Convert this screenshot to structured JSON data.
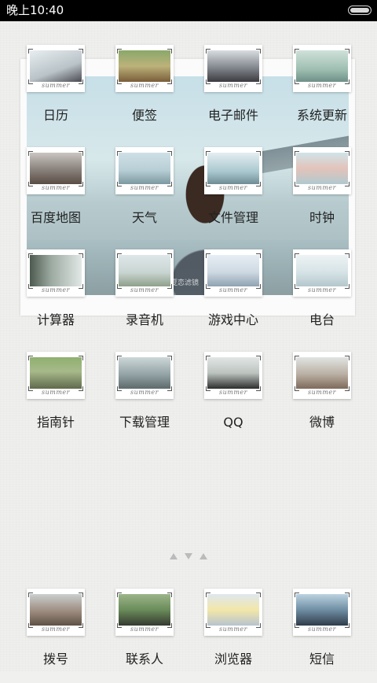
{
  "status_bar": {
    "time": "晚上10:40"
  },
  "widget": {
    "caption": "夏恋滤镜"
  },
  "apps": [
    {
      "label": "日历",
      "icon": "calendar-icon",
      "tag": "summer",
      "pic": "linear-gradient(160deg,#e8eef0,#b9c3c8 60%,#4a4a50)"
    },
    {
      "label": "便签",
      "icon": "notes-icon",
      "tag": "summer",
      "pic": "linear-gradient(180deg,#8aa86a,#bcb27a 50%,#7a5e3a)"
    },
    {
      "label": "电子邮件",
      "icon": "email-icon",
      "tag": "summer",
      "pic": "linear-gradient(180deg,#d9dde0,#8a8f96 50%,#3b3b40)"
    },
    {
      "label": "系统更新",
      "icon": "system-update-icon",
      "tag": "summer",
      "pic": "linear-gradient(180deg,#cfe1da,#9fbfb2 60%,#6e8f86)"
    },
    {
      "label": "百度地图",
      "icon": "map-icon",
      "tag": "summer",
      "pic": "linear-gradient(180deg,#c9c6c2,#8d8680 50%,#5a4d44)"
    },
    {
      "label": "天气",
      "icon": "weather-icon",
      "tag": "summer",
      "pic": "linear-gradient(180deg,#cfe0e6,#b8cfd6 55%,#7d98a0)"
    },
    {
      "label": "文件管理",
      "icon": "file-manager-icon",
      "tag": "summer",
      "pic": "linear-gradient(180deg,#e4eef1,#a9c8cf 60%,#6f8c94)"
    },
    {
      "label": "时钟",
      "icon": "clock-icon",
      "tag": "summer",
      "pic": "linear-gradient(180deg,#cfe4ea,#e3c3b9 50%,#b2c9cf)"
    },
    {
      "label": "计算器",
      "icon": "calculator-icon",
      "tag": "summer",
      "pic": "linear-gradient(90deg,#4d5a4e,#9aa9a0 40%,#e2e8e6)"
    },
    {
      "label": "录音机",
      "icon": "recorder-icon",
      "tag": "summer",
      "pic": "linear-gradient(180deg,#dfe7e9,#c9d5d2 55%,#8ea08a)"
    },
    {
      "label": "游戏中心",
      "icon": "game-center-icon",
      "tag": "summer",
      "pic": "linear-gradient(180deg,#e7eef4,#cdd9e2 55%,#8fa1b0)"
    },
    {
      "label": "电台",
      "icon": "radio-icon",
      "tag": "summer",
      "pic": "linear-gradient(180deg,#eef3f4,#d6e3e6 55%,#b3c7cc)"
    },
    {
      "label": "指南针",
      "icon": "compass-icon",
      "tag": "summer",
      "pic": "linear-gradient(180deg,#8fb070,#a7b98a 45%,#606a4c)"
    },
    {
      "label": "下载管理",
      "icon": "download-manager-icon",
      "tag": "summer",
      "pic": "linear-gradient(180deg,#cdd7d8,#93a3a6 55%,#5d6a6c)"
    },
    {
      "label": "QQ",
      "icon": "qq-icon",
      "tag": "summer",
      "pic": "linear-gradient(180deg,#e2e6e4,#bcc4c0 50%,#2d2d2d)"
    },
    {
      "label": "微博",
      "icon": "weibo-icon",
      "tag": "summer",
      "pic": "linear-gradient(180deg,#e1e4e3,#b9aea2 55%,#7d6a5b)"
    }
  ],
  "dock": [
    {
      "label": "拨号",
      "icon": "phone-icon",
      "tag": "summer",
      "pic": "linear-gradient(180deg,#c9cfcf,#9c8b7e 55%,#5f5146)"
    },
    {
      "label": "联系人",
      "icon": "contacts-icon",
      "tag": "summer",
      "pic": "linear-gradient(180deg,#9cb58a,#6a8c5a 50%,#343a30)"
    },
    {
      "label": "浏览器",
      "icon": "browser-icon",
      "tag": "summer",
      "pic": "linear-gradient(180deg,#dfe7ef,#f2e7a8 50%,#b6c4cf)"
    },
    {
      "label": "短信",
      "icon": "messages-icon",
      "tag": "summer",
      "pic": "linear-gradient(180deg,#bcd3e0,#6f8ea3 50%,#2f3c4a)"
    }
  ]
}
